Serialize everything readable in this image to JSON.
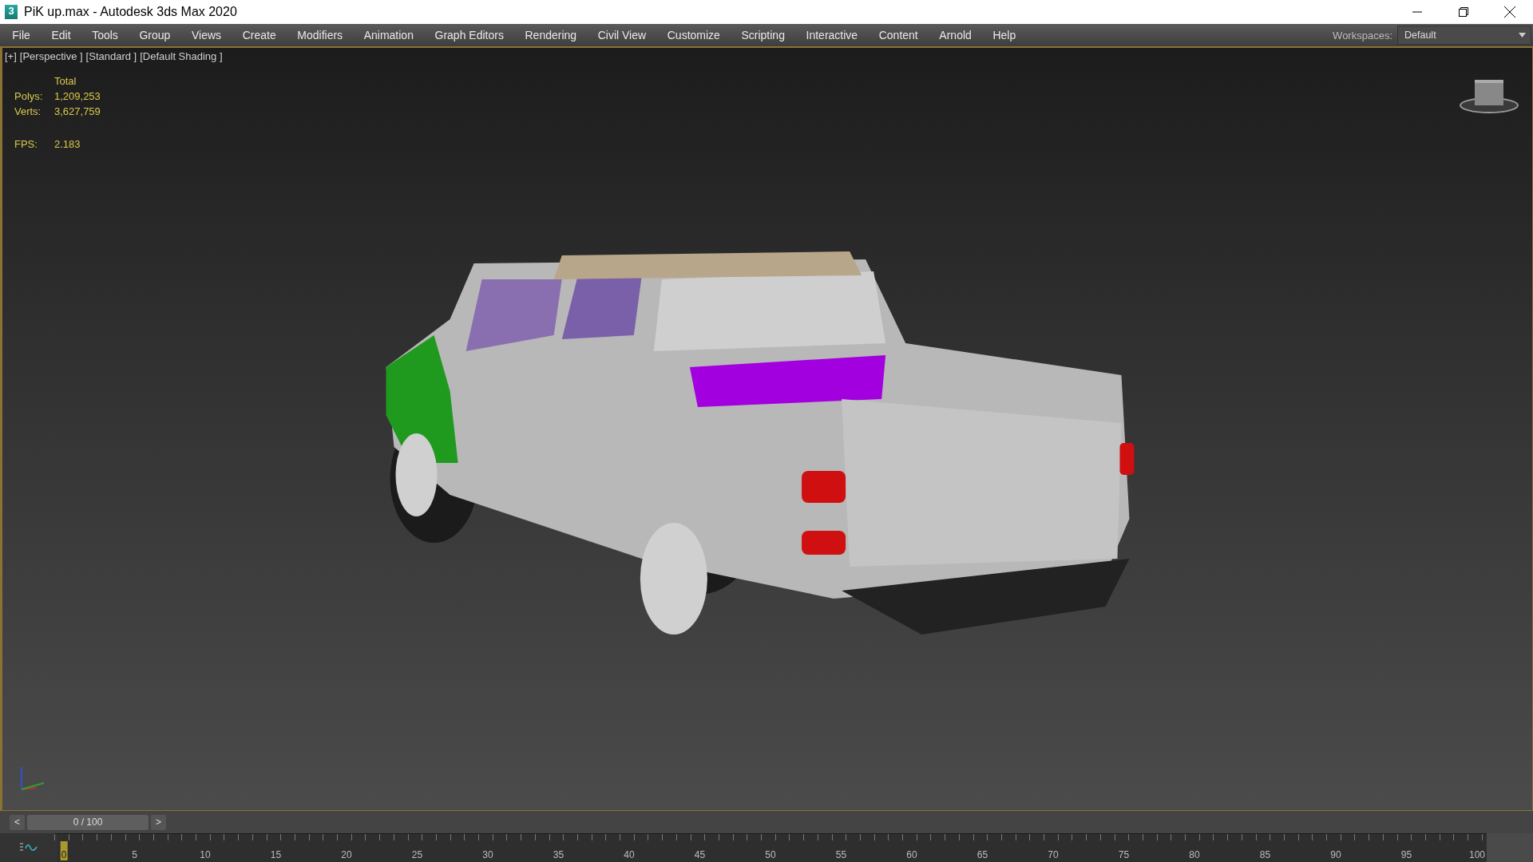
{
  "window": {
    "logo": "3",
    "title": "PiK up.max - Autodesk 3ds Max 2020"
  },
  "menu": [
    "File",
    "Edit",
    "Tools",
    "Group",
    "Views",
    "Create",
    "Modifiers",
    "Animation",
    "Graph Editors",
    "Rendering",
    "Civil View",
    "Customize",
    "Scripting",
    "Interactive",
    "Content",
    "Arnold",
    "Help"
  ],
  "workspaces": {
    "label": "Workspaces:",
    "value": "Default"
  },
  "viewport": {
    "labels": [
      "[+]",
      "[Perspective ]",
      "[Standard ]",
      "[Default Shading ]"
    ],
    "stats": {
      "header": "Total",
      "rows": [
        {
          "label": "Polys:",
          "value": "1,209,253"
        },
        {
          "label": "Verts:",
          "value": "3,627,759"
        }
      ],
      "fps_label": "FPS:",
      "fps_value": "2.183"
    }
  },
  "timeline": {
    "prev": "<",
    "frame": "0 / 100",
    "next": ">",
    "ruler": [
      {
        "text": "0",
        "selected": true
      },
      {
        "text": "5",
        "selected": false
      },
      {
        "text": "10",
        "selected": false
      },
      {
        "text": "15",
        "selected": false
      },
      {
        "text": "20",
        "selected": false
      },
      {
        "text": "25",
        "selected": false
      },
      {
        "text": "30",
        "selected": false
      },
      {
        "text": "35",
        "selected": false
      },
      {
        "text": "40",
        "selected": false
      },
      {
        "text": "45",
        "selected": false
      },
      {
        "text": "50",
        "selected": false
      },
      {
        "text": "55",
        "selected": false
      },
      {
        "text": "60",
        "selected": false
      },
      {
        "text": "65",
        "selected": false
      },
      {
        "text": "70",
        "selected": false
      },
      {
        "text": "75",
        "selected": false
      },
      {
        "text": "80",
        "selected": false
      },
      {
        "text": "85",
        "selected": false
      },
      {
        "text": "90",
        "selected": false
      },
      {
        "text": "95",
        "selected": false
      },
      {
        "text": "100",
        "selected": false
      }
    ]
  }
}
